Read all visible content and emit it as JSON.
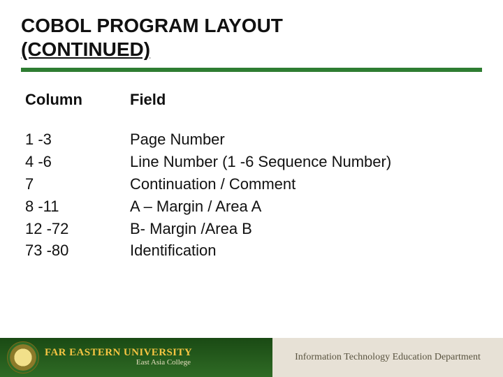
{
  "title": {
    "line1": "COBOL PROGRAM LAYOUT",
    "line2": "(CONTINUED)"
  },
  "table": {
    "headers": {
      "column": "Column",
      "field": "Field"
    },
    "rows": [
      {
        "column": "1 -3",
        "field": "Page Number"
      },
      {
        "column": "4 -6",
        "field": "Line Number (1 -6 Sequence Number)"
      },
      {
        "column": "7",
        "field": "Continuation / Comment"
      },
      {
        "column": "8 -11",
        "field": "A – Margin / Area A"
      },
      {
        "column": "12 -72",
        "field": "B- Margin /Area B"
      },
      {
        "column": "73 -80",
        "field": "Identification"
      }
    ],
    "columns_joined": "1 -3\n4 -6\n7\n8 -11\n12 -72\n73 -80",
    "fields_joined": "Page Number\nLine Number (1 -6 Sequence Number)\nContinuation / Comment\nA – Margin / Area A\nB- Margin /Area B\nIdentification"
  },
  "footer": {
    "university": "FAR EASTERN UNIVERSITY",
    "college": "East Asia College",
    "department": "Information Technology Education Department"
  }
}
